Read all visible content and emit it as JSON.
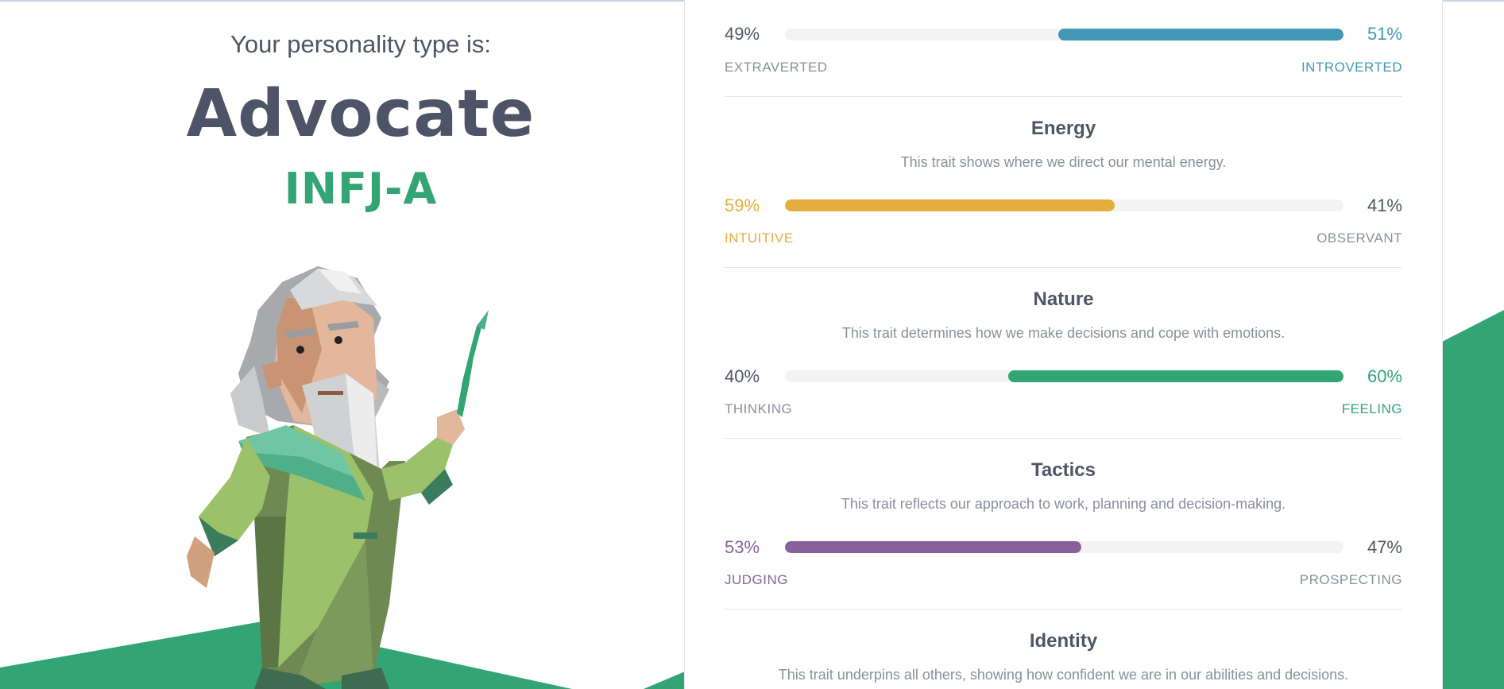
{
  "header": {
    "intro": "Your personality type is:",
    "type_name": "Advocate",
    "type_code": "INFJ-A"
  },
  "colors": {
    "green": "#33a474",
    "blue": "#4298b4",
    "yellow": "#e4ae3a",
    "purple": "#88619a",
    "text": "#4f5567",
    "muted": "#8a8f9c"
  },
  "traits": [
    {
      "title": "",
      "description": "",
      "left_pct": "49%",
      "right_pct": "51%",
      "left_label": "EXTRAVERTED",
      "right_label": "INTROVERTED",
      "dominant": "right",
      "fill_fraction": 0.51,
      "color": "#4298b4"
    },
    {
      "title": "Energy",
      "description": "This trait shows where we direct our mental energy.",
      "left_pct": "59%",
      "right_pct": "41%",
      "left_label": "INTUITIVE",
      "right_label": "OBSERVANT",
      "dominant": "left",
      "fill_fraction": 0.59,
      "color": "#e4ae3a"
    },
    {
      "title": "Nature",
      "description": "This trait determines how we make decisions and cope with emotions.",
      "left_pct": "40%",
      "right_pct": "60%",
      "left_label": "THINKING",
      "right_label": "FEELING",
      "dominant": "right",
      "fill_fraction": 0.6,
      "color": "#33a474"
    },
    {
      "title": "Tactics",
      "description": "This trait reflects our approach to work, planning and decision-making.",
      "left_pct": "53%",
      "right_pct": "47%",
      "left_label": "JUDGING",
      "right_label": "PROSPECTING",
      "dominant": "left",
      "fill_fraction": 0.53,
      "color": "#88619a"
    },
    {
      "title": "Identity",
      "description": "This trait underpins all others, showing how confident we are in our abilities and decisions."
    }
  ]
}
